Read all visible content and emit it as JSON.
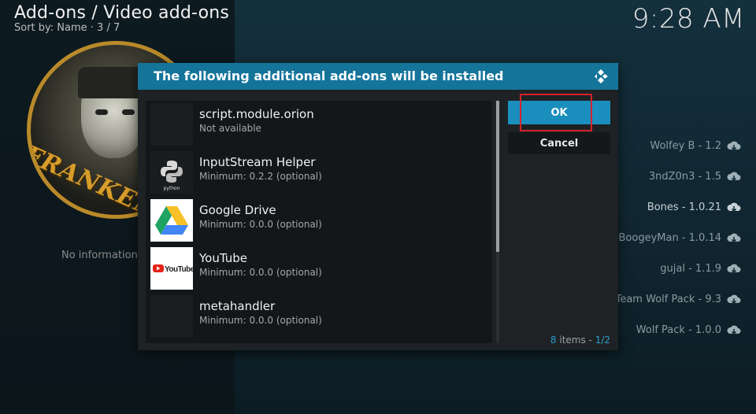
{
  "header": {
    "title": "Add-ons / Video add-ons",
    "subtitle": "Sort by: Name  ·  3 / 7",
    "clock": "9:28 AM"
  },
  "fanart": {
    "banner_text": "FRANKEN"
  },
  "no_info_text": "No information a",
  "addon_list": [
    {
      "label": "Wolfey B - 1.2",
      "icon": "cloud-download-icon"
    },
    {
      "label": "3ndZ0n3 - 1.5",
      "icon": "cloud-download-icon"
    },
    {
      "label": "Bones - 1.0.21",
      "icon": "cloud-download-icon"
    },
    {
      "label": "BoogeyMan - 1.0.14",
      "icon": "cloud-download-icon"
    },
    {
      "label": "gujal - 1.1.9",
      "icon": "cloud-download-icon"
    },
    {
      "label": "Team Wolf Pack - 9.3",
      "icon": "cloud-download-icon"
    },
    {
      "label": "Wolf Pack - 1.0.0",
      "icon": "cloud-download-icon"
    }
  ],
  "dialog": {
    "title": "The following additional add-ons will be installed",
    "ok_label": "OK",
    "cancel_label": "Cancel",
    "items_count": "8",
    "items_word": " items - ",
    "page": "1/2",
    "items": [
      {
        "name": "script.module.orion",
        "desc": "Not available",
        "thumb": "none"
      },
      {
        "name": "InputStream Helper",
        "desc": "Minimum: 0.2.2 (optional)",
        "thumb": "python-logo",
        "thumb_text": "python"
      },
      {
        "name": "Google Drive",
        "desc": "Minimum: 0.0.0 (optional)",
        "thumb": "google-drive-logo"
      },
      {
        "name": "YouTube",
        "desc": "Minimum: 0.0.0 (optional)",
        "thumb": "youtube-logo",
        "thumb_text": "YouTube"
      },
      {
        "name": "metahandler",
        "desc": "Minimum: 0.0.0 (optional)",
        "thumb": "none"
      }
    ]
  },
  "colors": {
    "accent": "#15749a",
    "ok_button": "#1a8fbd",
    "highlight_box": "#d6232b"
  }
}
